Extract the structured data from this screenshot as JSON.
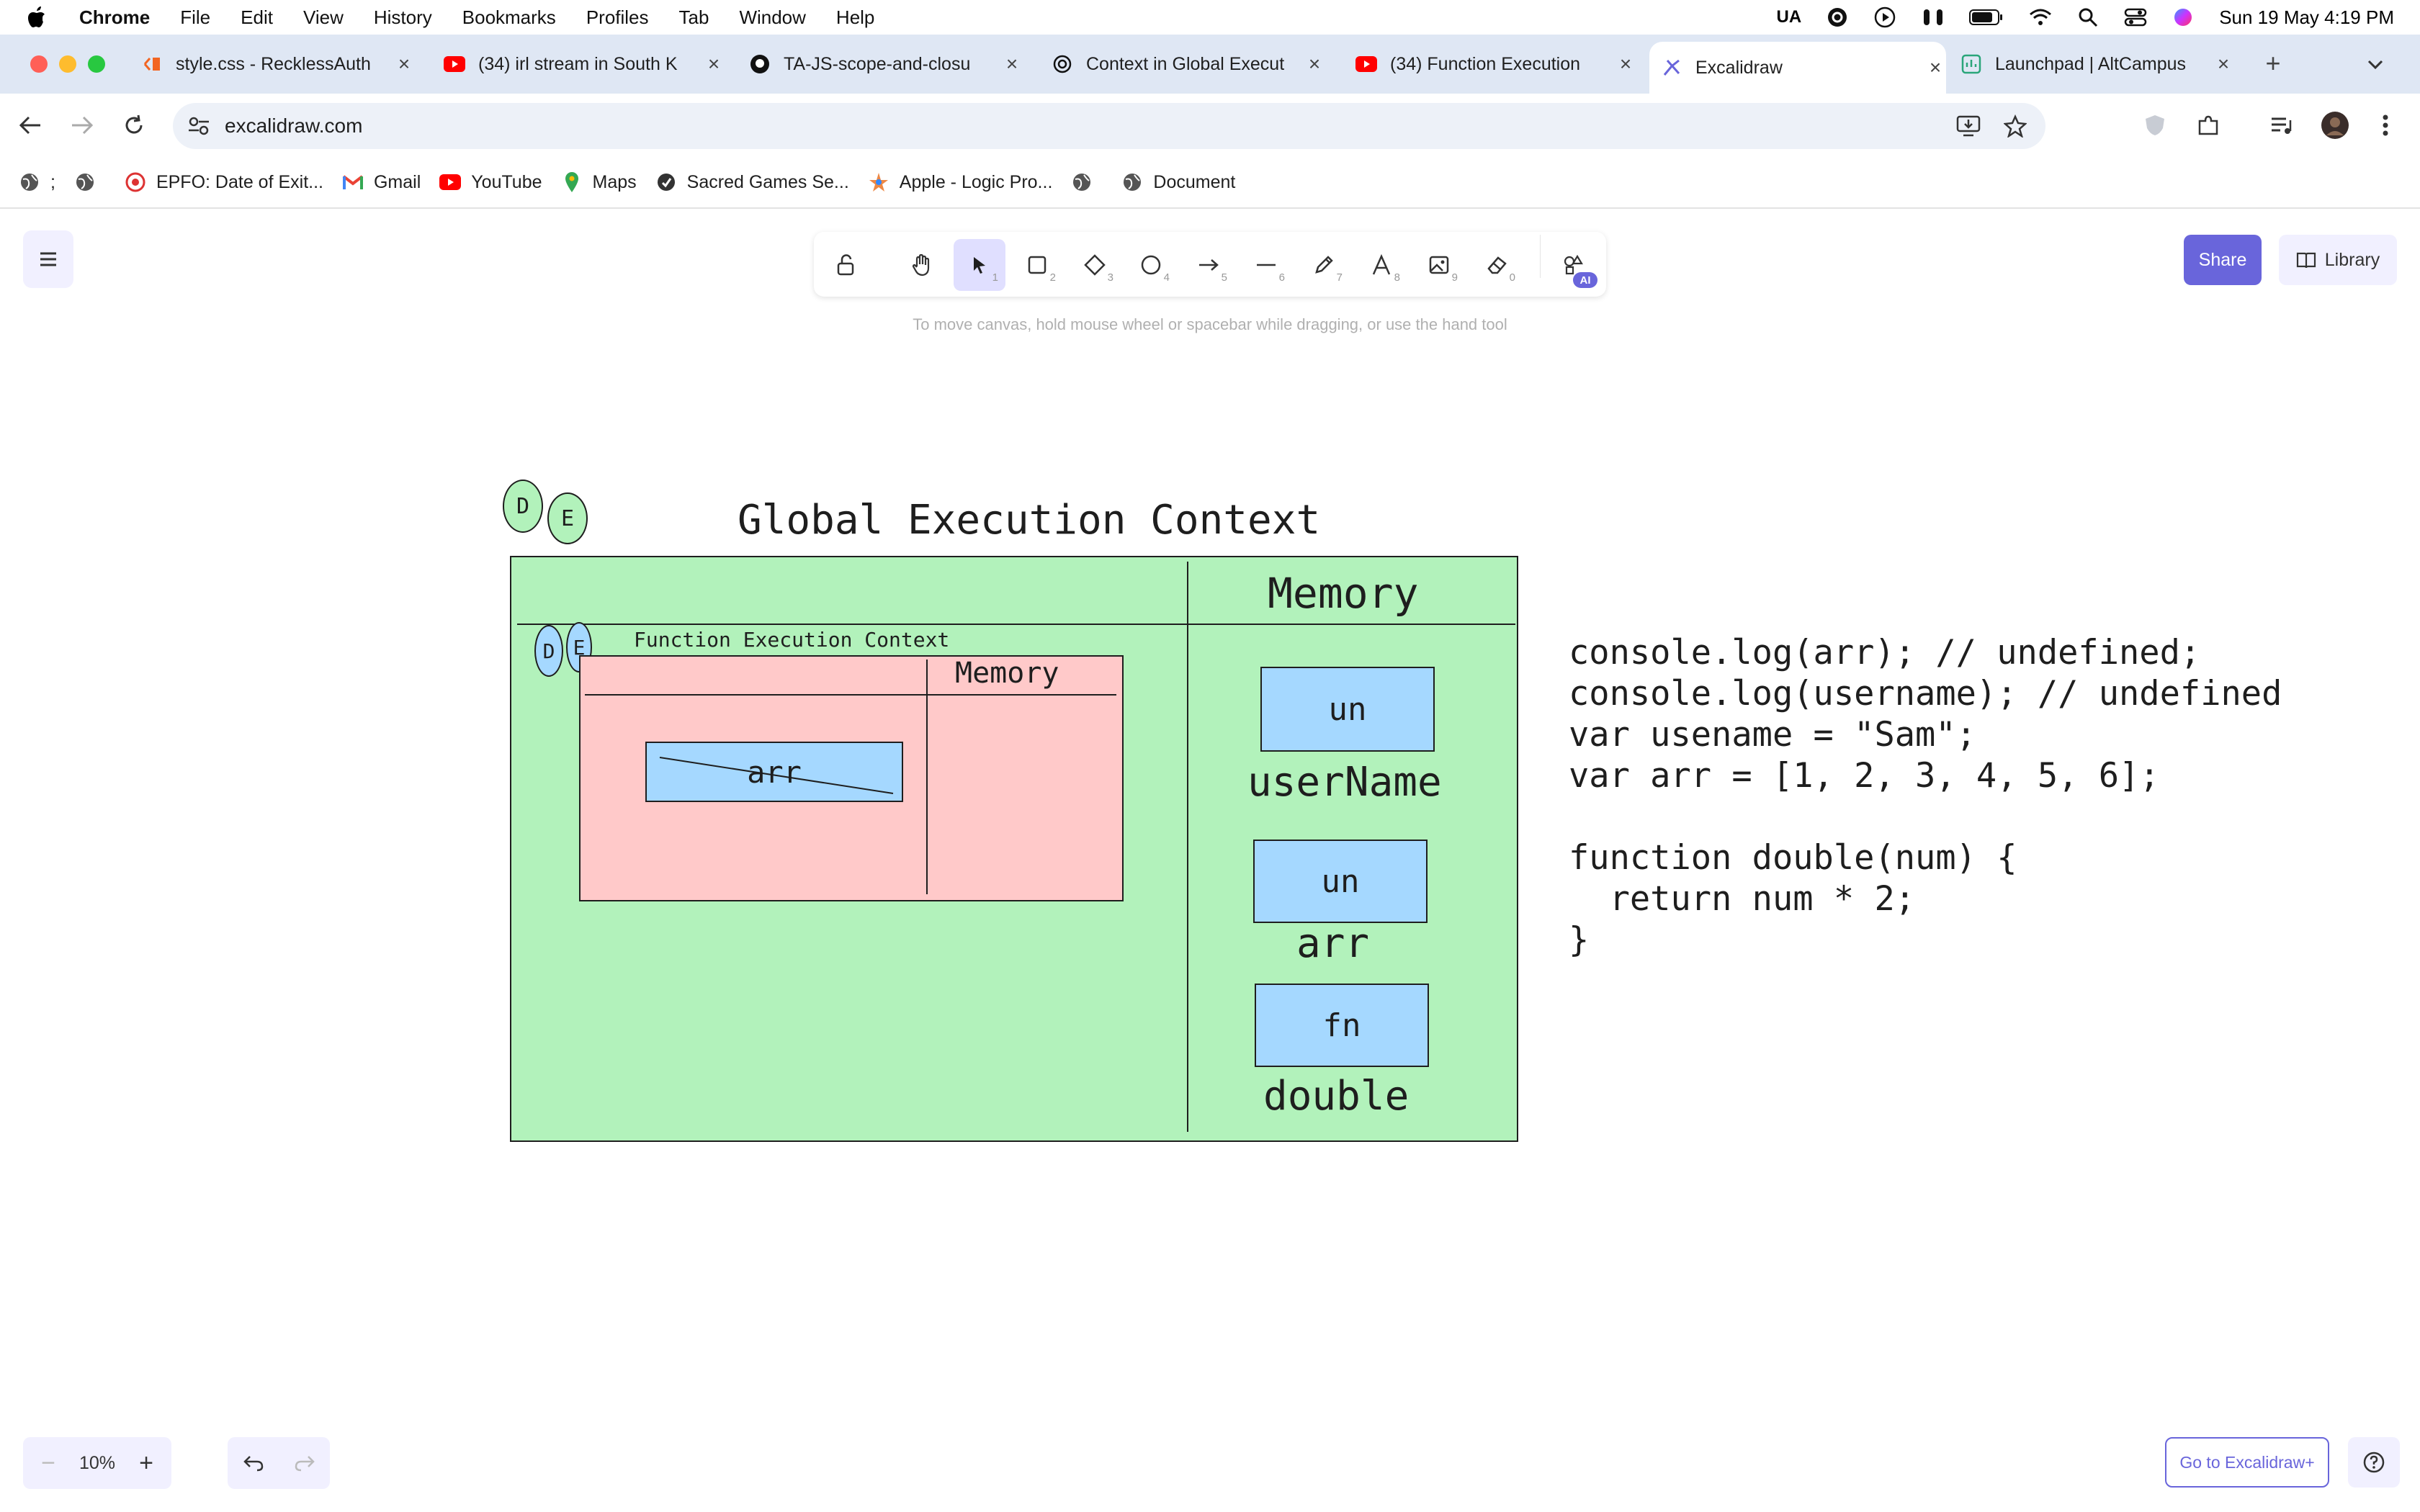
{
  "menubar": {
    "app": "Chrome",
    "items": [
      "File",
      "Edit",
      "View",
      "History",
      "Bookmarks",
      "Profiles",
      "Tab",
      "Window",
      "Help"
    ],
    "status_input": "UA",
    "clock": "Sun 19 May  4:19 PM"
  },
  "tabs": [
    {
      "title": "style.css - RecklessAuth",
      "icon": "code-icon"
    },
    {
      "title": "(34) irl stream in South K",
      "icon": "youtube-icon"
    },
    {
      "title": "TA-JS-scope-and-closu",
      "icon": "github-icon"
    },
    {
      "title": "Context in Global Execut",
      "icon": "chatgpt-icon"
    },
    {
      "title": "(34) Function Execution",
      "icon": "youtube-icon"
    },
    {
      "title": "Excalidraw",
      "icon": "excalidraw-icon",
      "active": true
    },
    {
      "title": "Launchpad | AltCampus",
      "icon": "altcampus-icon"
    }
  ],
  "address_bar": {
    "url": "excalidraw.com"
  },
  "bookmarks": [
    {
      "label": ";",
      "icon": "globe-icon"
    },
    {
      "label": "",
      "icon": "globe-icon"
    },
    {
      "label": "EPFO: Date of Exit...",
      "icon": "epfo-icon"
    },
    {
      "label": "Gmail",
      "icon": "gmail-icon"
    },
    {
      "label": "YouTube",
      "icon": "youtube-icon"
    },
    {
      "label": "Maps",
      "icon": "maps-icon"
    },
    {
      "label": "Sacred Games Se...",
      "icon": "shield-icon"
    },
    {
      "label": "Apple - Logic Pro...",
      "icon": "apple-star-icon"
    },
    {
      "label": "",
      "icon": "globe-icon"
    },
    {
      "label": "Document",
      "icon": "globe-icon"
    }
  ],
  "toolbar": {
    "keys": [
      "",
      "",
      "1",
      "2",
      "3",
      "4",
      "5",
      "6",
      "7",
      "8",
      "9",
      "0",
      ""
    ],
    "ai_badge": "AI",
    "hint": "To move canvas, hold mouse wheel or spacebar while dragging, or use the hand tool"
  },
  "top_right": {
    "share": "Share",
    "library": "Library"
  },
  "footer": {
    "zoom": "10%",
    "zoom_out": "−",
    "zoom_in": "+",
    "go_plus": "Go to Excalidraw+"
  },
  "canvas": {
    "global_title": "Global Execution Context",
    "global_memory": "Memory",
    "bubbles_outer": [
      "D",
      "E"
    ],
    "bubbles_inner": [
      "D",
      "E"
    ],
    "function_title": "Function Execution Context",
    "function_memory": "Memory",
    "function_cell": "arr",
    "memory_cells": [
      {
        "value": "un",
        "name": "userName"
      },
      {
        "value": "un",
        "name": "arr"
      },
      {
        "value": "fn",
        "name": "double"
      }
    ],
    "code": [
      "console.log(arr); // undefined;",
      "console.log(username); // undefined",
      "var usename = \"Sam\";",
      "var arr = [1, 2, 3, 4, 5, 6];",
      "",
      "function double(num) {",
      "  return num * 2;",
      "}"
    ]
  }
}
